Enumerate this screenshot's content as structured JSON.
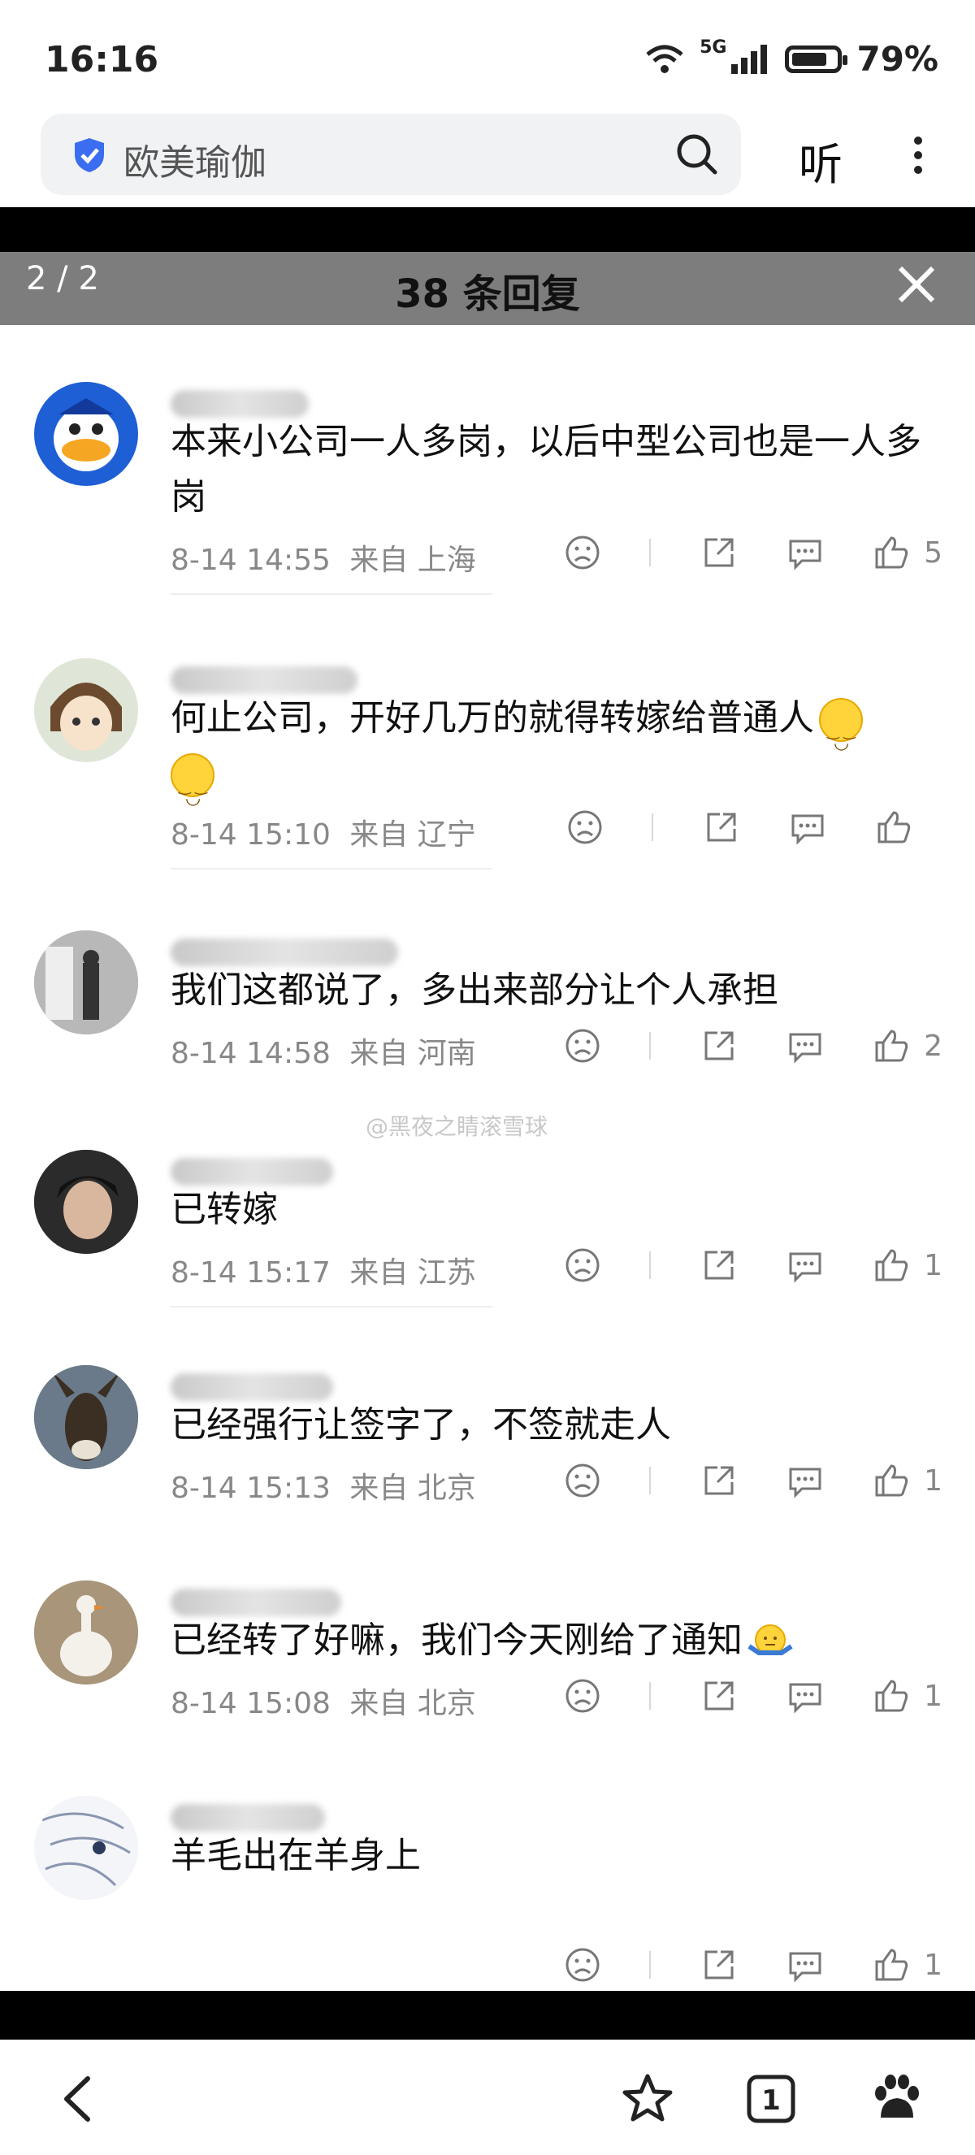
{
  "status_bar": {
    "time": "16:16",
    "network": "5G",
    "battery": "79%"
  },
  "search": {
    "query": "欧美瑜伽"
  },
  "toolbar": {
    "listen_label": "听"
  },
  "reply_panel": {
    "page_counter": "2 / 2",
    "title": "38 条回复"
  },
  "comments": [
    {
      "text": "本来小公司一人多岗，以后中型公司也是一人多岗",
      "date": "8-14 14:55",
      "location": "来自 上海",
      "likes": "5",
      "avatar_color": "#1e5fd6"
    },
    {
      "text": "何止公司，开好几万的就得转嫁给普通人",
      "date": "8-14 15:10",
      "location": "来自 辽宁",
      "likes": "",
      "avatar_color": "#6b8a5a"
    },
    {
      "text": "我们这都说了，多出来部分让个人承担",
      "date": "8-14 14:58",
      "location": "来自 河南",
      "likes": "2",
      "avatar_color": "#8c8c8c"
    },
    {
      "text": "已转嫁",
      "date": "8-14 15:17",
      "location": "来自 江苏",
      "likes": "1",
      "avatar_color": "#3a3a3a"
    },
    {
      "text": "已经强行让签字了，不签就走人",
      "date": "8-14 15:13",
      "location": "来自 北京",
      "likes": "1",
      "avatar_color": "#5a4a3a"
    },
    {
      "text": "已经转了好嘛，我们今天刚给了通知",
      "date": "8-14 15:08",
      "location": "来自 北京",
      "likes": "1",
      "avatar_color": "#b9a58a"
    },
    {
      "text": "羊毛出在羊身上",
      "date": "",
      "location": "",
      "likes": "1",
      "avatar_color": "#e8ecf2"
    }
  ],
  "watermark": "@黑夜之睛滚雪球",
  "colors": {
    "accent": "#3a6df0",
    "header_overlay": "#7d7d7d",
    "meta": "#888888"
  }
}
